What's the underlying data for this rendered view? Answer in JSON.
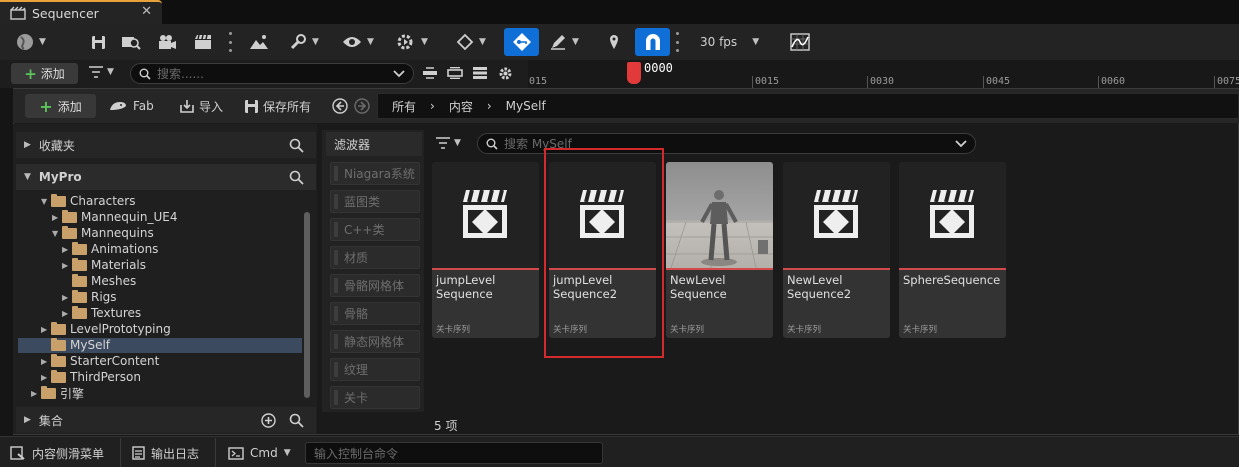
{
  "window": {
    "title": "Sequencer"
  },
  "toolbar": {
    "fps": "30 fps"
  },
  "sequencer": {
    "add_label": "添加",
    "search_placeholder": "搜索......",
    "current_frame": "0000",
    "ticks": [
      "015",
      "0015",
      "0030",
      "0045",
      "0060",
      "0075"
    ]
  },
  "browser": {
    "add_label": "添加",
    "fab_label": "Fab",
    "import_label": "导入",
    "saveall_label": "保存所有",
    "breadcrumbs": [
      "所有",
      "内容",
      "MySelf"
    ],
    "favorites_label": "收藏夹",
    "project_label": "MyPro",
    "collections_label": "集合",
    "tree": [
      {
        "label": "Characters",
        "depth": 1,
        "expanded": true
      },
      {
        "label": "Mannequin_UE4",
        "depth": 2,
        "expanded": false
      },
      {
        "label": "Mannequins",
        "depth": 2,
        "expanded": true
      },
      {
        "label": "Animations",
        "depth": 3,
        "expanded": false
      },
      {
        "label": "Materials",
        "depth": 3,
        "expanded": false
      },
      {
        "label": "Meshes",
        "depth": 3,
        "expanded": null
      },
      {
        "label": "Rigs",
        "depth": 3,
        "expanded": false
      },
      {
        "label": "Textures",
        "depth": 3,
        "expanded": false
      },
      {
        "label": "LevelPrototyping",
        "depth": 1,
        "expanded": false
      },
      {
        "label": "MySelf",
        "depth": 1,
        "expanded": null,
        "selected": true
      },
      {
        "label": "StarterContent",
        "depth": 1,
        "expanded": false
      },
      {
        "label": "ThirdPerson",
        "depth": 1,
        "expanded": false
      },
      {
        "label": "引擎",
        "depth": 0,
        "expanded": false
      }
    ],
    "filters_label": "滤波器",
    "filters": [
      "Niagara系统",
      "蓝图类",
      "C++类",
      "材质",
      "骨骼网格体",
      "骨骼",
      "静态网格体",
      "纹理",
      "关卡"
    ],
    "asset_search_placeholder": "搜索 MySelf",
    "assets": [
      {
        "name": "jumpLevel Sequence",
        "type": "关卡序列",
        "thumb": "clapper-icon"
      },
      {
        "name": "jumpLevel Sequence2",
        "type": "关卡序列",
        "thumb": "clapper-icon",
        "highlighted": true
      },
      {
        "name": "NewLevel Sequence",
        "type": "关卡序列",
        "thumb": "mannequin-preview"
      },
      {
        "name": "NewLevel Sequence2",
        "type": "关卡序列",
        "thumb": "clapper-icon"
      },
      {
        "name": "SphereSequence",
        "type": "关卡序列",
        "thumb": "clapper-icon"
      }
    ],
    "item_count": "5 项"
  },
  "statusbar": {
    "drawer_label": "内容侧滑菜单",
    "log_label": "输出日志",
    "cmd_label": "Cmd",
    "cmd_placeholder": "输入控制台命令"
  },
  "colors": {
    "accent": "#0f6fd6",
    "highlight": "#d32b2b",
    "playhead": "#e23a3a",
    "tab_top": "#e9a23b"
  }
}
